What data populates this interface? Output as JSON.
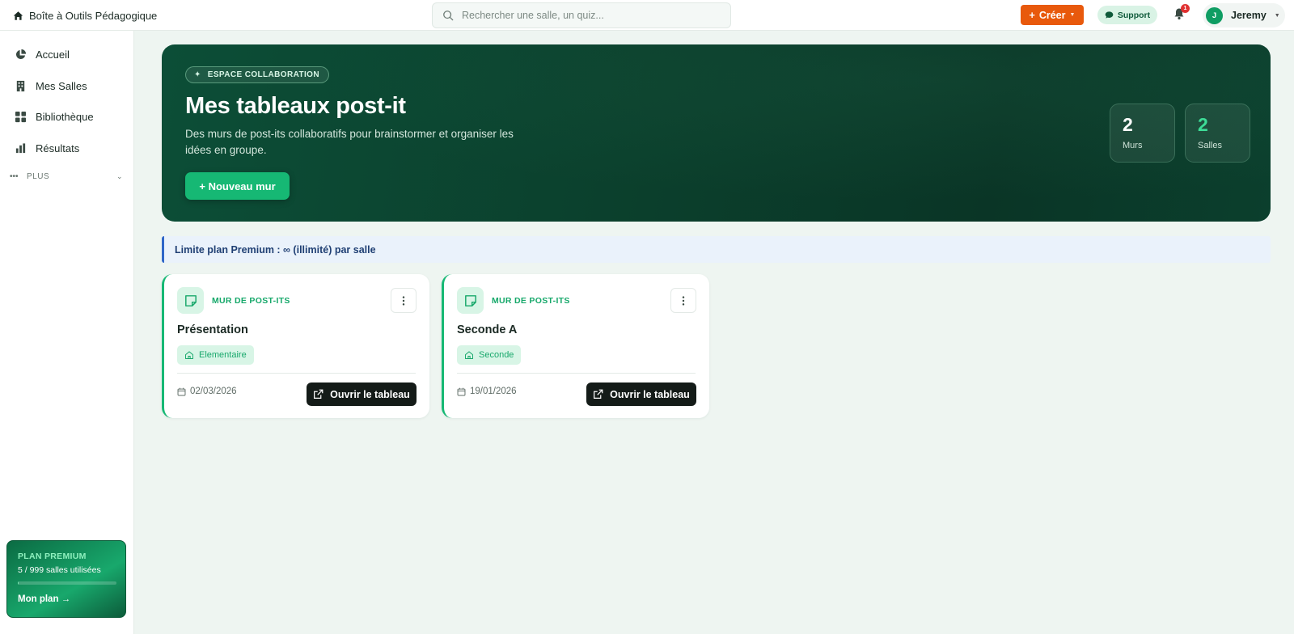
{
  "header": {
    "brand": "Boîte à Outils Pédagogique",
    "search_placeholder": "Rechercher une salle, un quiz...",
    "create_label": "Créer",
    "support_label": "Support",
    "notification_count": "1",
    "user_initial": "J",
    "user_name": "Jeremy"
  },
  "sidebar": {
    "items": [
      {
        "label": "Accueil",
        "icon": "pie-chart-icon"
      },
      {
        "label": "Mes Salles",
        "icon": "building-icon"
      },
      {
        "label": "Bibliothèque",
        "icon": "grid-icon"
      },
      {
        "label": "Résultats",
        "icon": "bar-chart-icon"
      }
    ],
    "more_label": "PLUS",
    "plan": {
      "title": "PLAN PREMIUM",
      "usage": "5 / 999 salles utilisées",
      "usage_fraction": 0.005,
      "link": "Mon plan →"
    }
  },
  "hero": {
    "badge": "ESPACE COLLABORATION",
    "title": "Mes tableaux post-it",
    "subtitle": "Des murs de post-its collaboratifs pour brainstormer et organiser les idées en groupe.",
    "new_button": "+ Nouveau mur",
    "stats": [
      {
        "value": "2",
        "label": "Murs",
        "color": "#ffffff"
      },
      {
        "value": "2",
        "label": "Salles",
        "color": "#3ddc97"
      }
    ]
  },
  "notice": "Limite plan Premium : ∞ (illimité) par salle",
  "cards": [
    {
      "type": "MUR DE POST-ITS",
      "title": "Présentation",
      "tag": "Elementaire",
      "date": "02/03/2026",
      "open_label": "Ouvrir le tableau"
    },
    {
      "type": "MUR DE POST-ITS",
      "title": "Seconde A",
      "tag": "Seconde",
      "date": "19/01/2026",
      "open_label": "Ouvrir le tableau"
    }
  ],
  "colors": {
    "accent": "#16b874",
    "create": "#e8590c",
    "hero_bg": "#0b3f2c"
  }
}
